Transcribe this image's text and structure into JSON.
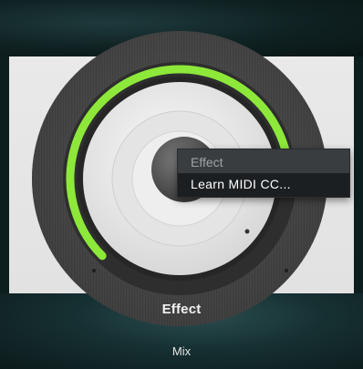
{
  "knob": {
    "label": "Effect",
    "level": 0.82,
    "accent_color": "#8de83a"
  },
  "mix": {
    "label": "Mix"
  },
  "context_menu": {
    "title": "Effect",
    "items": [
      {
        "label": "Learn MIDI CC..."
      }
    ]
  }
}
